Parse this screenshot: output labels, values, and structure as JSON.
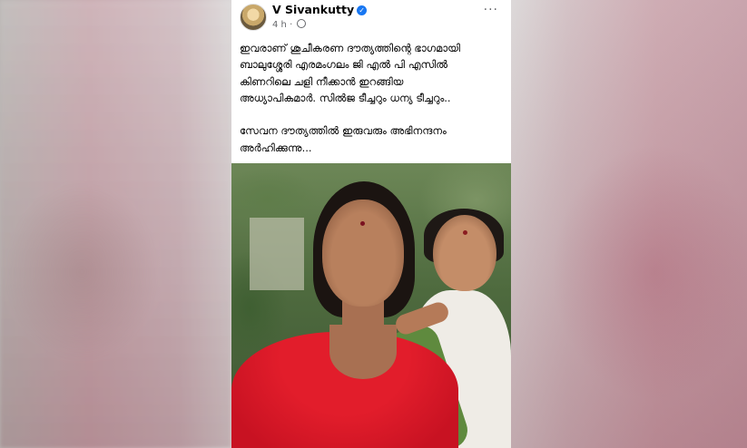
{
  "post": {
    "author": "V Sivankutty",
    "verified_icon": "verified-badge-icon",
    "time": "4 h",
    "separator": " · ",
    "audience_icon": "globe-icon",
    "menu_icon": "more-options-icon",
    "menu_glyph": "···",
    "text": "ഇവരാണ് ശുചീകരണ ദൗത്യത്തിന്റെ ഭാഗമായി\nബാലുശ്ശേരി എരമംഗലം ജി എൽ പി എസിൽ\nകിണറിലെ ചളി നീക്കാൻ ഇറങ്ങിയ\nഅധ്യാപികമാർ. സിൽജ ടീച്ചറും ധന്യ ടീച്ചറും..\n\nസേവന ദൗത്യത്തിൽ ഇരുവരും അഭിനന്ദനം\nഅർഹിക്കുന്നു..."
  },
  "colors": {
    "verified": "#1877f2",
    "meta_text": "#65676b",
    "saree_red": "#e21d2b"
  }
}
